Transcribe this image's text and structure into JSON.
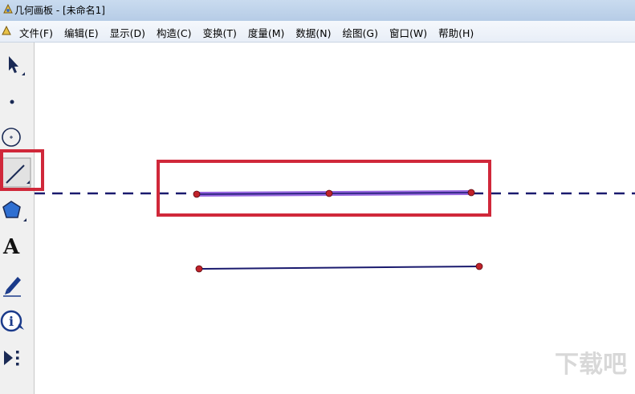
{
  "window": {
    "title": "几何画板 - [未命名1]"
  },
  "menu": {
    "items": [
      "文件(F)",
      "编辑(E)",
      "显示(D)",
      "构造(C)",
      "变换(T)",
      "度量(M)",
      "数据(N)",
      "绘图(G)",
      "窗口(W)",
      "帮助(H)"
    ]
  },
  "toolbar": {
    "tools": [
      {
        "icon": "arrow-select-icon"
      },
      {
        "icon": "point-icon"
      },
      {
        "icon": "compass-circle-icon"
      },
      {
        "icon": "straightedge-icon",
        "selected": true
      },
      {
        "icon": "polygon-icon"
      },
      {
        "icon": "text-tool-icon",
        "label": "A"
      },
      {
        "icon": "marker-pen-icon"
      },
      {
        "icon": "info-icon",
        "label": "i"
      },
      {
        "icon": "custom-tools-icon"
      }
    ]
  },
  "watermark": {
    "text": "下载吧"
  },
  "colors": {
    "highlight": "#d0283a",
    "line": "#1a1a6e",
    "selected_segment": "#7b3fd6",
    "point": "#c0222a"
  }
}
